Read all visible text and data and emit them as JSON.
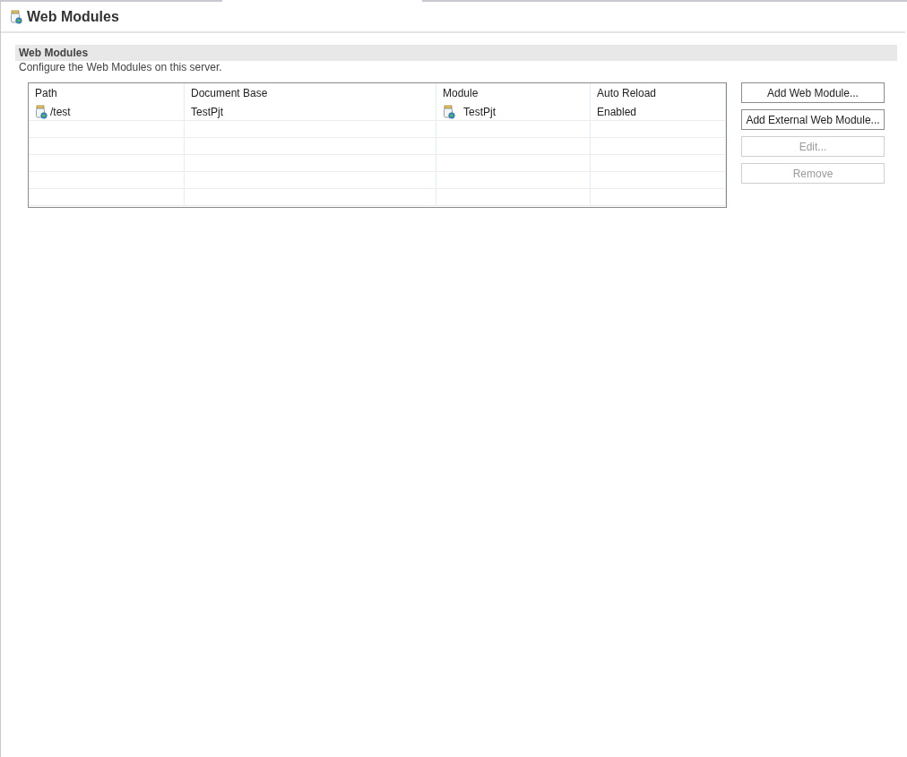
{
  "editor": {
    "title": "Web Modules"
  },
  "section": {
    "title": "Web Modules",
    "description": "Configure the Web Modules on this server."
  },
  "table": {
    "columns": [
      "Path",
      "Document Base",
      "Module",
      "Auto Reload"
    ],
    "rows": [
      {
        "path": "/test",
        "document_base": "TestPjt",
        "module": "TestPjt",
        "auto_reload": "Enabled",
        "selected": false
      }
    ]
  },
  "buttons": [
    {
      "label": "Add Web Module...",
      "disabled": false
    },
    {
      "label": "Add External Web Module...",
      "disabled": false
    },
    {
      "label": "Edit...",
      "disabled": true
    },
    {
      "label": "Remove",
      "disabled": true
    }
  ]
}
